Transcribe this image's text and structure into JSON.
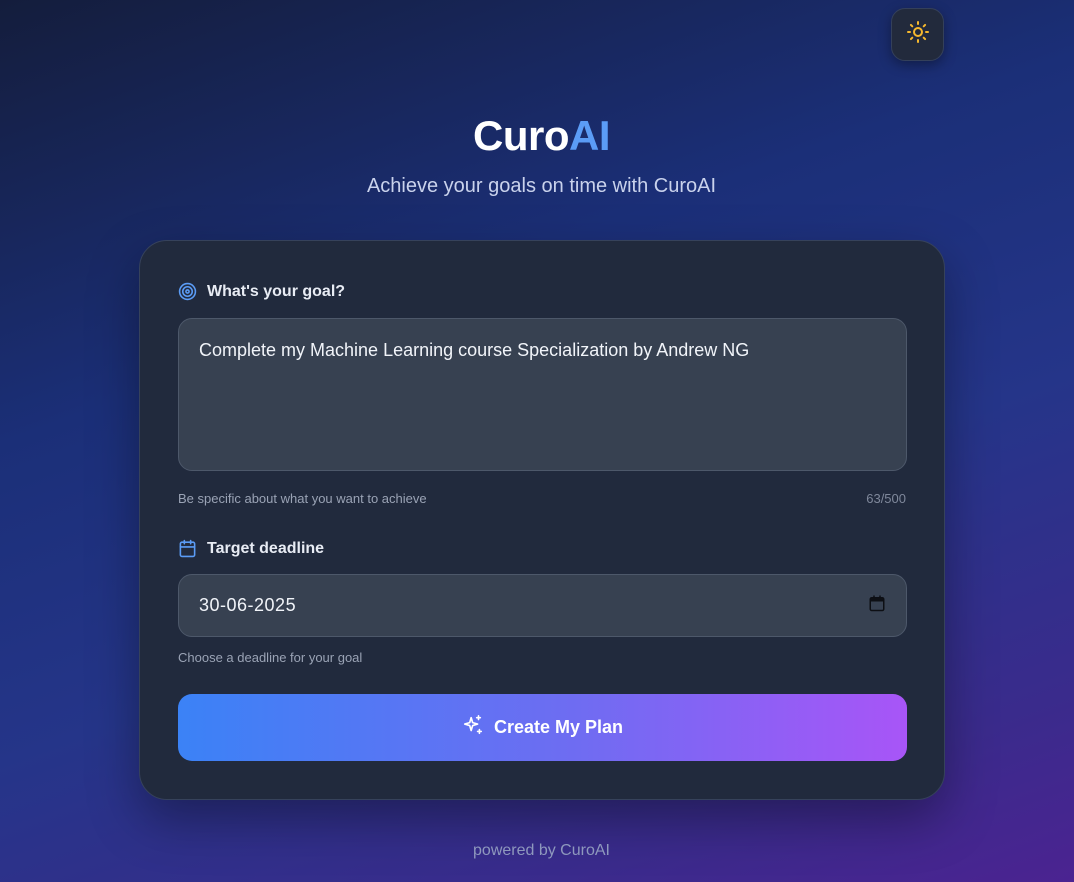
{
  "theme_toggle": {
    "icon": "sun-icon",
    "accent": "#f5b82e"
  },
  "header": {
    "brand_part1": "Curo",
    "brand_part2": "AI",
    "tagline": "Achieve your goals on time with CuroAI"
  },
  "form": {
    "goal": {
      "label": "What's your goal?",
      "icon": "target-icon",
      "value": "Complete my Machine Learning course Specialization by Andrew NG",
      "hint": "Be specific about what you want to achieve",
      "counter": "63/500"
    },
    "deadline": {
      "label": "Target deadline",
      "icon": "calendar-icon",
      "value": "30-06-2025",
      "hint": "Choose a deadline for your goal"
    },
    "submit": {
      "label": "Create My Plan",
      "icon": "sparkles-icon"
    }
  },
  "footer": {
    "text": "powered by CuroAI"
  },
  "colors": {
    "accent_blue": "#5b9cf6",
    "gradient_start": "#3b82f6",
    "gradient_end": "#a855f7",
    "card_bg": "#212a3d",
    "input_bg": "#374151"
  }
}
